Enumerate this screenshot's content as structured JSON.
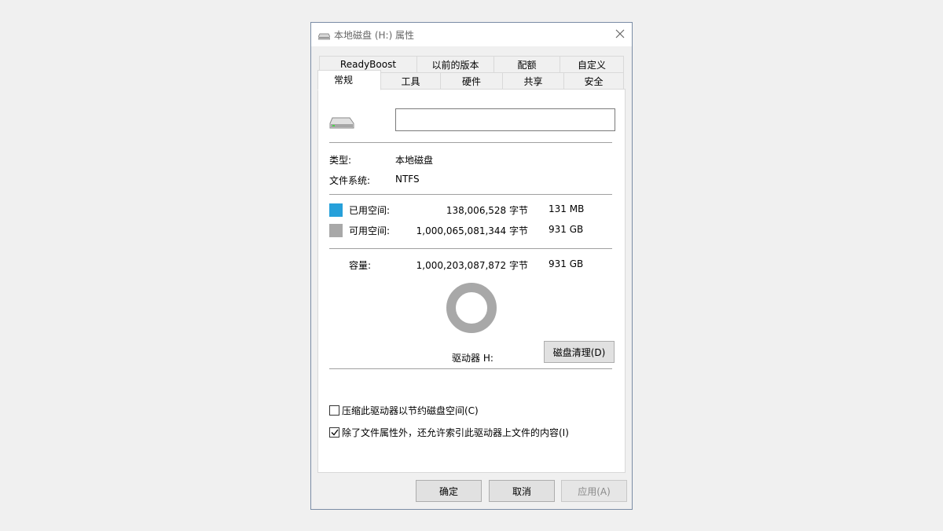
{
  "window": {
    "title": "本地磁盘 (H:) 属性"
  },
  "tabs_row1": [
    "ReadyBoost",
    "以前的版本",
    "配额",
    "自定义"
  ],
  "tabs_row2": [
    "常规",
    "工具",
    "硬件",
    "共享",
    "安全"
  ],
  "active_tab": "常规",
  "general": {
    "name_value": "",
    "type_label": "类型:",
    "type_value": "本地磁盘",
    "fs_label": "文件系统:",
    "fs_value": "NTFS",
    "used_label": "已用空间:",
    "used_bytes": "138,006,528 字节",
    "used_size": "131 MB",
    "used_color": "#26a0da",
    "free_label": "可用空间:",
    "free_bytes": "1,000,065,081,344 字节",
    "free_size": "931 GB",
    "free_color": "#a8a8a8",
    "capacity_label": "容量:",
    "capacity_bytes": "1,000,203,087,872 字节",
    "capacity_size": "931 GB",
    "used_fraction": 0.000138,
    "drive_label": "驱动器 H:",
    "cleanup_button": "磁盘清理(D)",
    "compress_label": "压缩此驱动器以节约磁盘空间(C)",
    "compress_checked": false,
    "index_label": "除了文件属性外，还允许索引此驱动器上文件的内容(I)",
    "index_checked": true
  },
  "buttons": {
    "ok": "确定",
    "cancel": "取消",
    "apply": "应用(A)"
  },
  "icons": {
    "title_icon": "drive-icon",
    "close_icon": "close-icon",
    "checkmark": "checkmark-icon"
  }
}
